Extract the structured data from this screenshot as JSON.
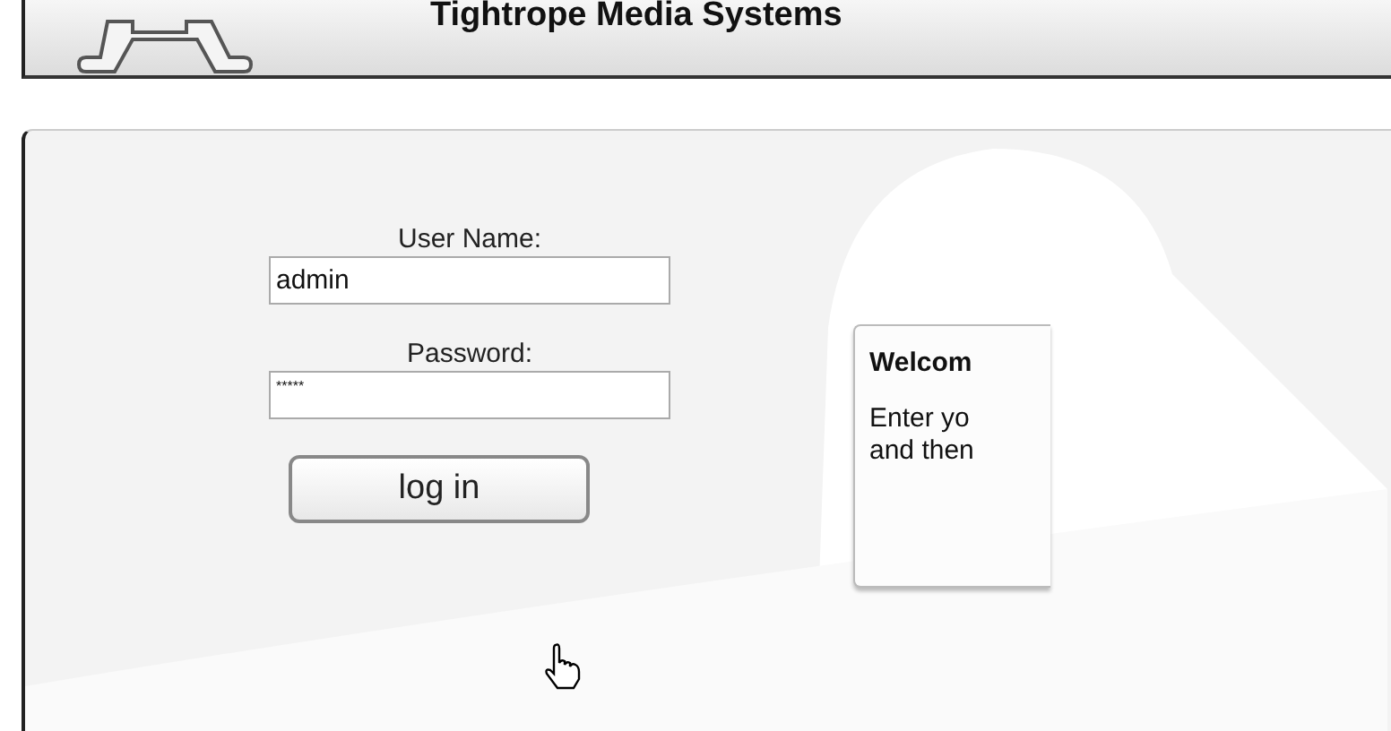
{
  "header": {
    "title": "Tightrope Media Systems"
  },
  "login": {
    "username_label": "User Name:",
    "username_value": "admin",
    "password_label": "Password:",
    "password_value": "*****",
    "button": "log in"
  },
  "welcome": {
    "title": "Welcom",
    "lines": [
      "Enter yo",
      "and then"
    ]
  }
}
